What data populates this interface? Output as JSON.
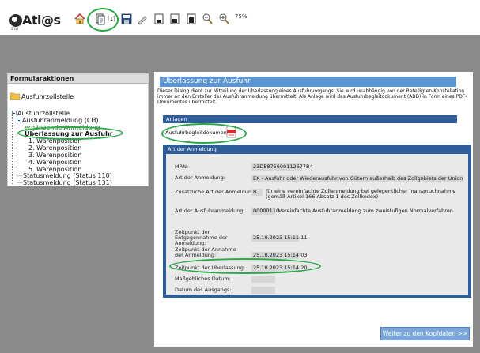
{
  "app": {
    "logo_text": "Atl@s",
    "logo_sub": "Z.IW"
  },
  "toolbar": {
    "icons": [
      "home-icon",
      "document-count-icon",
      "save-icon",
      "edit-icon",
      "page-1-icon",
      "page-2-icon",
      "page-3-icon",
      "zoom-out-icon",
      "zoom-in-icon"
    ],
    "doc_count": "[1]",
    "zoom": "75%"
  },
  "sidebar": {
    "title": "Formularaktionen",
    "root": "Ausfuhrzollstelle",
    "tree": {
      "node1": "Ausfuhrzollstelle",
      "node2": "Ausfuhranmeldung (CH)",
      "node3": "ergänzende Anmeldung",
      "node4": "Überlassung zur Ausfuhr",
      "pos1": "1. Warenposition",
      "pos2": "2. Warenposition",
      "pos3": "3. Warenposition",
      "pos4": "4. Warenposition",
      "pos5": "5. Warenposition",
      "status1": "Statusmeldung (Status 110)",
      "status2": "Statusmeldung (Status 131)"
    }
  },
  "dialog": {
    "title": "Überlassung zur Ausfuhr",
    "description": "Dieser Dialog dient zur Mitteilung der Überlassung eines Ausfuhrvorgangs. Sie wird unabhängig von der Beteiligten-Konstellation immer an den Ersteller der Ausfuhranmeldung übermittelt. Als Anlage wird das Ausfuhrbegleitdokument (ABD) in Form eines PDF-Dokumentes übermittelt.",
    "attachments": {
      "section_title": "Anlagen",
      "item_label": "Ausfuhrbegleitdokument"
    },
    "export_section": {
      "title": "Art der Anmeldung",
      "mrn_label": "MRN:",
      "mrn_value": "23DE875600112677B4",
      "art_label": "Art der Anmeldung:",
      "art_value": "EX - Ausfuhr oder Wiederausfuhr von Gütern außerhalb des Zollgebiets der Union",
      "zus_label": "Zusätzliche Art der Anmeldung:",
      "zus_code": "B",
      "zus_text": "für eine vereinfachte Zollanmeldung bei gelegentlicher Inanspruchnahme (gemäß Artikel 166 Absatz 1 des Zollkodex)",
      "art_ausfuhr_label": "Art der Ausfuhranmeldung:",
      "art_ausfuhr_code": "00000110",
      "art_ausfuhr_text": "Vereinfachte Ausfuhranmeldung zum zweistufigen Normalverfahren",
      "entgegen_label": "Zeitpunkt der Entgegennahme der Anmeldung:",
      "entgegen_value": "25.10.2023 15:11:11",
      "annahme_label": "Zeitpunkt der Annahme der Anmeldung:",
      "annahme_value": "25.10.2023 15:14:03",
      "ueberlassung_label": "Zeitpunkt der Überlassung:",
      "ueberlassung_value": "25.10.2023 15:14:20",
      "datum_label": "Maßgebliches Datum:",
      "ausgang_label": "Datum des Ausgangs:"
    },
    "next_button": "Weiter zu den Kopfdaten >>"
  }
}
